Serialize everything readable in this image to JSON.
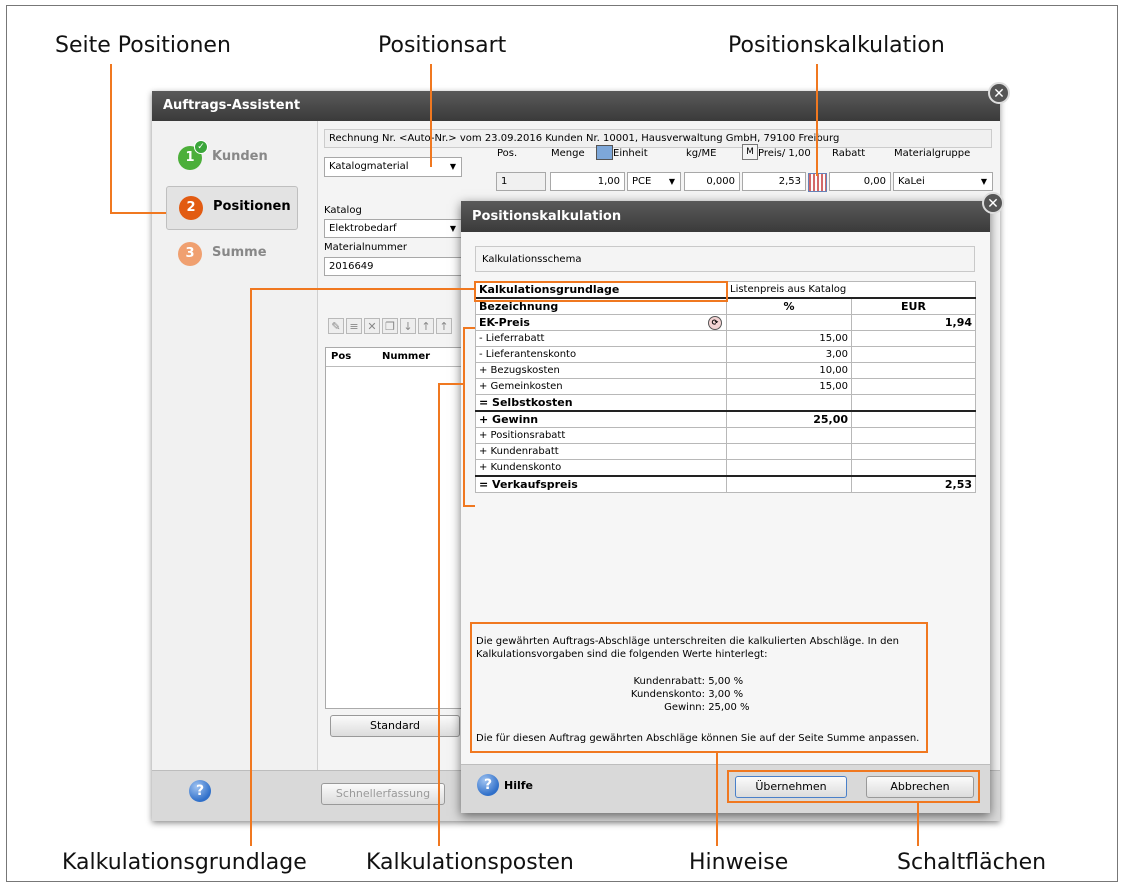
{
  "callouts": {
    "seite_positionen": "Seite Positionen",
    "positionsart": "Positionsart",
    "positionskalkulation": "Positionskalkulation",
    "kalkulationsgrundlage": "Kalkulationsgrundlage",
    "kalkulationsposten": "Kalkulationsposten",
    "hinweise": "Hinweise",
    "schaltflaechen": "Schaltflächen"
  },
  "wizard": {
    "title": "Auftrags-Assistent",
    "steps": [
      {
        "num": "1",
        "label": "Kunden",
        "color": "#4caf3a"
      },
      {
        "num": "2",
        "label": "Positionen",
        "color": "#e25b12"
      },
      {
        "num": "3",
        "label": "Summe",
        "color": "#f0a070"
      }
    ],
    "header_info": "Rechnung Nr. <Auto-Nr.> vom 23.09.2016 Kunden Nr. 10001, Hausverwaltung GmbH, 79100 Freiburg",
    "positionsart_value": "Katalogmaterial",
    "labels": {
      "pos": "Pos.",
      "menge": "Menge",
      "einheit": "Einheit",
      "kgme": "kg/ME",
      "m": "M",
      "preis": "Preis/ 1,00",
      "rabatt": "Rabatt",
      "materialgruppe": "Materialgruppe",
      "katalog": "Katalog",
      "materialnummer": "Materialnummer"
    },
    "values": {
      "pos": "1",
      "menge": "1,00",
      "einheit": "PCE",
      "kgme": "0,000",
      "preis": "2,53",
      "rabatt": "0,00",
      "materialgruppe": "KaLei",
      "katalog": "Elektrobedarf",
      "materialnummer": "2016649"
    },
    "list_headers": [
      "Pos",
      "Nummer"
    ],
    "standard_button": "Standard",
    "schnellerfassung_button": "Schnellerfassung"
  },
  "dialog": {
    "title": "Positionskalkulation",
    "schema_label": "Kalkulationsschema",
    "grundlage_label": "Kalkulationsgrundlage",
    "grundlage_value": "Listenpreis aus Katalog",
    "col_bezeichnung": "Bezeichnung",
    "col_percent": "%",
    "col_eur": "EUR",
    "rows": [
      {
        "label": "EK-Preis",
        "percent": "",
        "eur": "1,94"
      },
      {
        "label": "- Lieferrabatt",
        "percent": "15,00",
        "eur": ""
      },
      {
        "label": "- Lieferantenskonto",
        "percent": "3,00",
        "eur": ""
      },
      {
        "label": "+ Bezugskosten",
        "percent": "10,00",
        "eur": ""
      },
      {
        "label": "+ Gemeinkosten",
        "percent": "15,00",
        "eur": ""
      },
      {
        "label": "= Selbstkosten",
        "percent": "",
        "eur": ""
      },
      {
        "label": "+ Gewinn",
        "percent": "25,00",
        "eur": ""
      },
      {
        "label": "+ Positionsrabatt",
        "percent": "",
        "eur": ""
      },
      {
        "label": "+ Kundenrabatt",
        "percent": "",
        "eur": ""
      },
      {
        "label": "+ Kundenskonto",
        "percent": "",
        "eur": ""
      },
      {
        "label": "= Verkaufspreis",
        "percent": "",
        "eur": "2,53"
      }
    ],
    "hint": {
      "text1": "Die gewährten Auftrags-Abschläge unterschreiten die kalkulierten Abschläge. In den Kalkulationsvorgaben sind die folgenden Werte hinterlegt:",
      "items": [
        {
          "label": "Kundenrabatt:",
          "value": "5,00 %"
        },
        {
          "label": "Kundenskonto:",
          "value": "3,00 %"
        },
        {
          "label": "Gewinn:",
          "value": "25,00 %"
        }
      ],
      "text2": "Die für diesen Auftrag gewährten Abschläge können Sie auf der Seite Summe anpassen."
    },
    "hilfe_label": "Hilfe",
    "uebernehmen": "Übernehmen",
    "abbrechen": "Abbrechen"
  },
  "colors": {
    "accent": "#f07820"
  }
}
